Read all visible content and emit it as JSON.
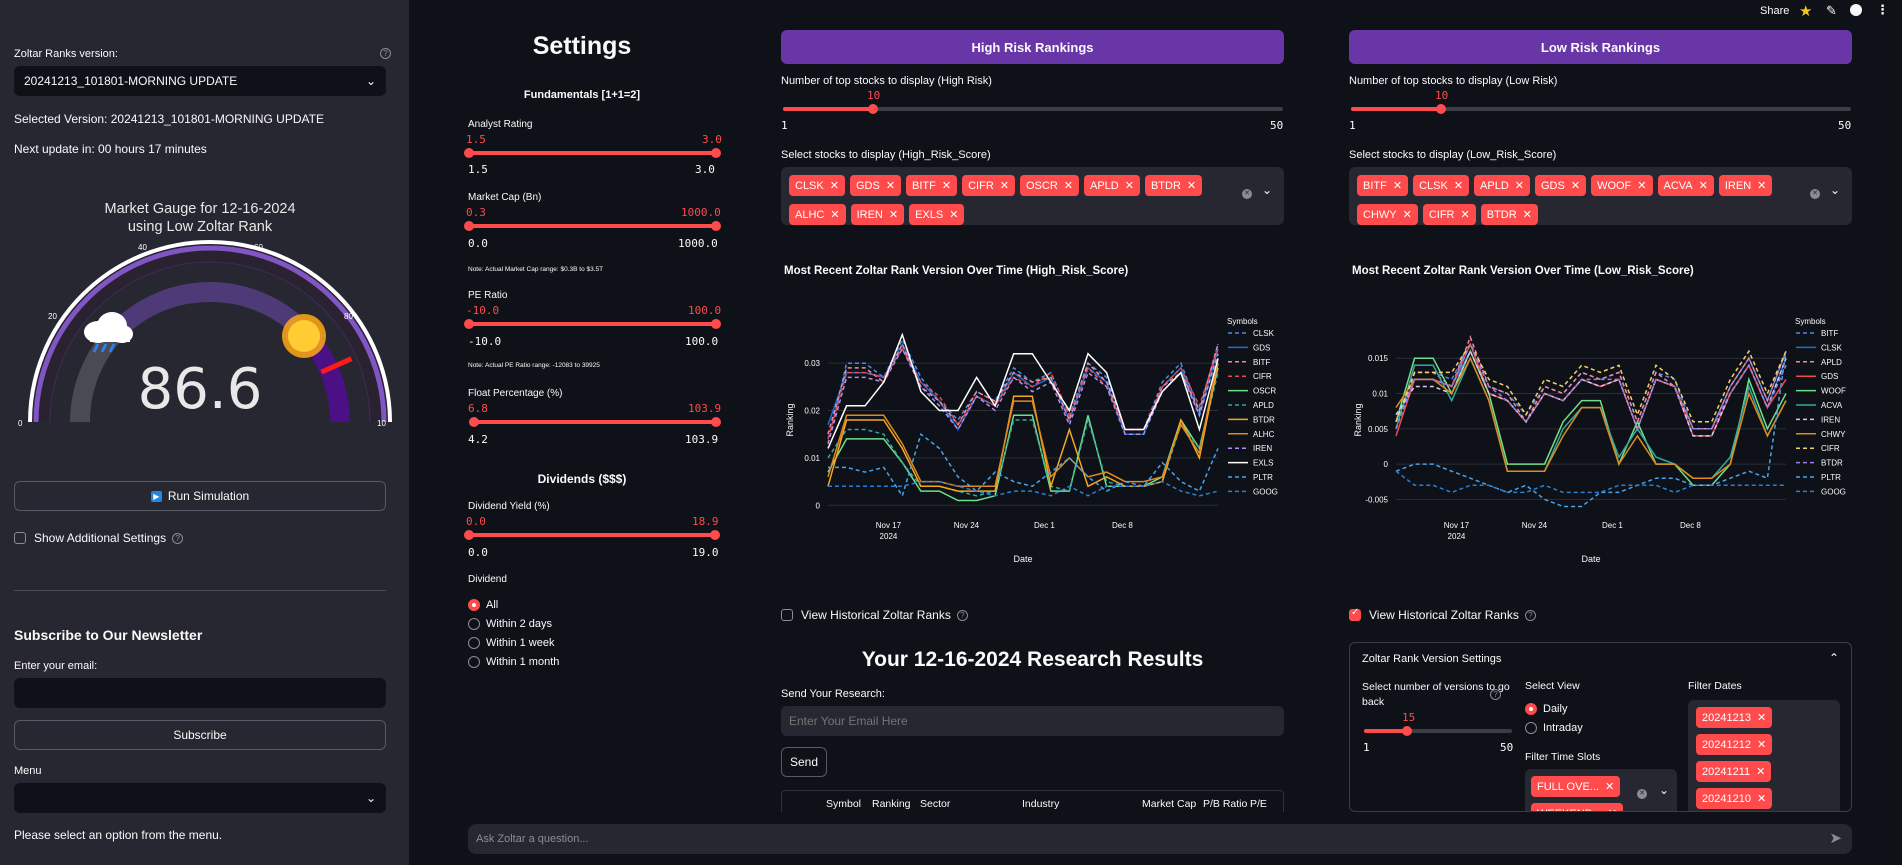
{
  "toolbar": {
    "share": "Share"
  },
  "sidebar": {
    "version_label": "Zoltar Ranks version:",
    "version_value": "20241213_101801-MORNING UPDATE",
    "selected_version": "Selected Version: 20241213_101801-MORNING UPDATE",
    "next_update": "Next update in: 00 hours 17 minutes",
    "gauge": {
      "title_line1": "Market Gauge for 12-16-2024",
      "title_line2": "using Low Zoltar Rank",
      "value": "86.6",
      "reading": 86.6,
      "ticks": [
        "0",
        "20",
        "40",
        "60",
        "80",
        "10"
      ]
    },
    "run_simulation": "Run Simulation",
    "show_additional": "Show Additional Settings",
    "newsletter_title": "Subscribe to Our Newsletter",
    "email_label": "Enter your email:",
    "subscribe": "Subscribe",
    "menu_label": "Menu",
    "menu_hint": "Please select an option from the menu."
  },
  "settings": {
    "title": "Settings",
    "fundamentals": "Fundamentals [1+1=2]",
    "analyst": {
      "label": "Analyst Rating",
      "lo": "1.5",
      "hi": "3.0",
      "min": "1.5",
      "max": "3.0"
    },
    "marketcap": {
      "label": "Market Cap (Bn)",
      "lo": "0.3",
      "hi": "1000.0",
      "min": "0.0",
      "max": "1000.0",
      "note": "Note: Actual Market Cap range: $0.3B to $3.5T"
    },
    "pe": {
      "label": "PE Ratio",
      "lo": "-10.0",
      "hi": "100.0",
      "min": "-10.0",
      "max": "100.0",
      "note": "Note: Actual PE Ratio range: -12083 to 39925"
    },
    "float": {
      "label": "Float Percentage (%)",
      "lo": "6.8",
      "hi": "103.9",
      "min": "4.2",
      "max": "103.9"
    },
    "dividends": "Dividends ($$$)",
    "divyield": {
      "label": "Dividend Yield (%)",
      "lo": "0.0",
      "hi": "18.9",
      "min": "0.0",
      "max": "19.0"
    },
    "dividend_label": "Dividend",
    "dividend_options": [
      "All",
      "Within 2 days",
      "Within 1 week",
      "Within 1 month"
    ]
  },
  "high": {
    "title": "High Risk Rankings",
    "num_label": "Number of top stocks to display (High Risk)",
    "num_value": "10",
    "num_min": "1",
    "num_max": "50",
    "select_label": "Select stocks to display (High_Risk_Score)",
    "tags": [
      "CLSK",
      "GDS",
      "BITF",
      "CIFR",
      "OSCR",
      "APLD",
      "BTDR",
      "ALHC",
      "IREN",
      "EXLS"
    ],
    "chart_title": "Most Recent Zoltar Rank Version Over Time (High_Risk_Score)",
    "view_hist": "View Historical Zoltar Ranks"
  },
  "low": {
    "title": "Low Risk Rankings",
    "num_label": "Number of top stocks to display (Low Risk)",
    "num_value": "10",
    "num_min": "1",
    "num_max": "50",
    "select_label": "Select stocks to display (Low_Risk_Score)",
    "tags": [
      "BITF",
      "CLSK",
      "APLD",
      "GDS",
      "WOOF",
      "ACVA",
      "IREN",
      "CHWY",
      "CIFR",
      "BTDR"
    ],
    "chart_title": "Most Recent Zoltar Rank Version Over Time (Low_Risk_Score)",
    "view_hist": "View Historical Zoltar Ranks"
  },
  "research": {
    "title": "Your 12-16-2024 Research Results",
    "send_label": "Send Your Research:",
    "email_placeholder": "Enter Your Email Here",
    "send": "Send",
    "columns": [
      "Symbol",
      "Ranking",
      "Sector",
      "Industry",
      "Market Cap",
      "P/B Ratio",
      "P/E Ra"
    ]
  },
  "version_settings": {
    "title": "Zoltar Rank Version Settings",
    "num_label_1": "Select number of versions to go",
    "num_label_2": "back",
    "num_value": "15",
    "num_min": "1",
    "num_max": "50",
    "view_label": "Select View",
    "view_options": [
      "Daily",
      "Intraday"
    ],
    "slots_label": "Filter Time Slots",
    "slots": [
      "FULL OVE...",
      "WEEKEND..."
    ],
    "dates_label": "Filter Dates",
    "dates": [
      "20241213",
      "20241212",
      "20241211",
      "20241210"
    ]
  },
  "chat": {
    "placeholder": "Ask Zoltar a question..."
  },
  "chart_data": [
    {
      "type": "line",
      "title": "Most Recent Zoltar Rank Version Over Time (High_Risk_Score)",
      "xlabel": "Date",
      "ylabel": "Ranking",
      "legend_title": "Symbols",
      "legend_position": "right",
      "x_ticks": [
        "Nov 17\n2024",
        "Nov 24",
        "Dec 1",
        "Dec 8"
      ],
      "y_ticks": [
        "0",
        "0.01",
        "0.02",
        "0.03"
      ],
      "ylim": [
        -0.001,
        0.037
      ],
      "series": [
        {
          "name": "CLSK",
          "color": "#4c8ce8",
          "dash": true,
          "values": [
            0.013,
            0.03,
            0.03,
            0.027,
            0.035,
            0.027,
            0.022,
            0.018,
            0.024,
            0.022,
            0.029,
            0.026,
            0.028,
            0.019,
            0.03,
            0.027,
            0.016,
            0.016,
            0.026,
            0.03,
            0.02,
            0.034
          ]
        },
        {
          "name": "GDS",
          "color": "#1f6fd0",
          "dash": false,
          "values": [
            0.017,
            0.028,
            0.028,
            0.027,
            0.034,
            0.026,
            0.022,
            0.016,
            0.023,
            0.021,
            0.028,
            0.025,
            0.027,
            0.018,
            0.029,
            0.026,
            0.015,
            0.015,
            0.025,
            0.029,
            0.019,
            0.033
          ]
        },
        {
          "name": "BITF",
          "color": "#f08aa0",
          "dash": true,
          "values": [
            0.015,
            0.029,
            0.029,
            0.026,
            0.034,
            0.025,
            0.022,
            0.017,
            0.024,
            0.022,
            0.028,
            0.026,
            0.027,
            0.018,
            0.03,
            0.026,
            0.016,
            0.016,
            0.025,
            0.028,
            0.02,
            0.034
          ]
        },
        {
          "name": "CIFR",
          "color": "#ef4b4b",
          "dash": true,
          "values": [
            0.014,
            0.028,
            0.028,
            0.027,
            0.033,
            0.026,
            0.023,
            0.017,
            0.023,
            0.021,
            0.027,
            0.025,
            0.028,
            0.019,
            0.029,
            0.025,
            0.016,
            0.016,
            0.025,
            0.029,
            0.021,
            0.033
          ]
        },
        {
          "name": "OSCR",
          "color": "#6fe08a",
          "dash": false,
          "values": [
            0.007,
            0.014,
            0.014,
            0.014,
            0.009,
            0.003,
            0.003,
            0.001,
            0.001,
            0.002,
            0.019,
            0.019,
            0.003,
            0.003,
            0.019,
            0.004,
            0.004,
            0.004,
            0.006,
            0.018,
            0.012,
            0.029
          ]
        },
        {
          "name": "APLD",
          "color": "#35a7a0",
          "dash": true,
          "values": [
            0.01,
            0.016,
            0.016,
            0.015,
            0.009,
            0.004,
            0.004,
            0.003,
            0.002,
            0.003,
            0.018,
            0.018,
            0.004,
            0.003,
            0.018,
            0.005,
            0.004,
            0.004,
            0.005,
            0.017,
            0.012,
            0.028
          ]
        },
        {
          "name": "BTDR",
          "color": "#f5a623",
          "dash": false,
          "values": [
            0.004,
            0.018,
            0.018,
            0.018,
            0.012,
            0.004,
            0.004,
            0.003,
            0.003,
            0.003,
            0.023,
            0.023,
            0.004,
            0.016,
            0.004,
            0.006,
            0.004,
            0.004,
            0.005,
            0.018,
            0.01,
            0.03
          ]
        },
        {
          "name": "ALHC",
          "color": "#e08a1e",
          "dash": false,
          "values": [
            0.006,
            0.019,
            0.019,
            0.019,
            0.013,
            0.005,
            0.005,
            0.004,
            0.004,
            0.004,
            0.022,
            0.022,
            0.006,
            0.01,
            0.006,
            0.007,
            0.005,
            0.005,
            0.006,
            0.017,
            0.011,
            0.031
          ]
        },
        {
          "name": "IREN",
          "color": "#b18cf2",
          "dash": true,
          "values": [
            0.013,
            0.027,
            0.027,
            0.026,
            0.033,
            0.025,
            0.021,
            0.016,
            0.023,
            0.02,
            0.027,
            0.024,
            0.026,
            0.017,
            0.028,
            0.025,
            0.015,
            0.015,
            0.024,
            0.028,
            0.019,
            0.032
          ]
        },
        {
          "name": "EXLS",
          "color": "#ffffff",
          "dash": false,
          "values": [
            0.012,
            0.021,
            0.021,
            0.026,
            0.036,
            0.024,
            0.02,
            0.02,
            0.027,
            0.021,
            0.032,
            0.032,
            0.026,
            0.02,
            0.032,
            0.028,
            0.016,
            0.016,
            0.024,
            0.028,
            0.016,
            0.031
          ]
        },
        {
          "name": "PLTR",
          "color": "#4aa3e8",
          "dash": true,
          "values": [
            0.008,
            0.008,
            0.007,
            0.008,
            0.002,
            0.015,
            0.012,
            0.006,
            0.003,
            0.007,
            0.005,
            0.004,
            0.007,
            0.01,
            0.006,
            0.003,
            0.005,
            0.004,
            0.009,
            0.005,
            0.003,
            0.012
          ]
        },
        {
          "name": "GOOG",
          "color": "#2a7fd4",
          "dash": true,
          "values": [
            0.004,
            0.004,
            0.004,
            0.004,
            0.004,
            0.005,
            0.005,
            0.004,
            0.003,
            0.002,
            0.003,
            0.003,
            0.002,
            0.004,
            0.002,
            0.004,
            0.004,
            0.004,
            0.005,
            0.003,
            0.002,
            0.003
          ]
        }
      ]
    },
    {
      "type": "line",
      "title": "Most Recent Zoltar Rank Version Over Time (Low_Risk_Score)",
      "xlabel": "Date",
      "ylabel": "Ranking",
      "legend_title": "Symbols",
      "legend_position": "right",
      "x_ticks": [
        "Nov 17\n2024",
        "Nov 24",
        "Dec 1",
        "Dec 8"
      ],
      "y_ticks": [
        "-0.005",
        "0",
        "0.005",
        "0.01",
        "0.015"
      ],
      "ylim": [
        -0.0065,
        0.019
      ],
      "series": [
        {
          "name": "BITF",
          "color": "#4c8ce8",
          "dash": true,
          "values": [
            0.005,
            0.013,
            0.013,
            0.012,
            0.017,
            0.011,
            0.01,
            0.007,
            0.011,
            0.01,
            0.013,
            0.012,
            0.013,
            0.006,
            0.013,
            0.012,
            0.005,
            0.005,
            0.011,
            0.015,
            0.009,
            0.016
          ]
        },
        {
          "name": "CLSK",
          "color": "#1f6fd0",
          "dash": false,
          "values": [
            0.006,
            0.012,
            0.012,
            0.011,
            0.016,
            0.01,
            0.009,
            0.006,
            0.01,
            0.009,
            0.012,
            0.011,
            0.012,
            0.005,
            0.012,
            0.011,
            0.004,
            0.004,
            0.01,
            0.014,
            0.008,
            0.015
          ]
        },
        {
          "name": "APLD",
          "color": "#f08aa0",
          "dash": true,
          "values": [
            0.005,
            0.013,
            0.013,
            0.011,
            0.018,
            0.011,
            0.01,
            0.006,
            0.011,
            0.01,
            0.013,
            0.012,
            0.013,
            0.006,
            0.013,
            0.011,
            0.005,
            0.005,
            0.011,
            0.015,
            0.009,
            0.016
          ]
        },
        {
          "name": "GDS",
          "color": "#ef4b4b",
          "dash": false,
          "values": [
            0.004,
            0.012,
            0.012,
            0.011,
            0.017,
            0.01,
            0.009,
            0.006,
            0.01,
            0.009,
            0.012,
            0.011,
            0.012,
            0.005,
            0.012,
            0.011,
            0.004,
            0.004,
            0.01,
            0.014,
            0.008,
            0.012
          ]
        },
        {
          "name": "WOOF",
          "color": "#6fe08a",
          "dash": false,
          "values": [
            0.006,
            0.015,
            0.015,
            0.01,
            0.016,
            0.01,
            0.0,
            0.0,
            0.0,
            0.006,
            0.009,
            0.009,
            0.0,
            0.006,
            0.0,
            0.0,
            -0.003,
            -0.003,
            0.0,
            0.012,
            0.005,
            0.01
          ]
        },
        {
          "name": "ACVA",
          "color": "#35a7a0",
          "dash": false,
          "values": [
            0.005,
            0.014,
            0.014,
            0.009,
            0.015,
            0.009,
            -0.001,
            -0.001,
            -0.001,
            0.005,
            0.008,
            0.008,
            0.001,
            0.005,
            0.001,
            0.0,
            -0.002,
            -0.002,
            0.001,
            0.011,
            0.004,
            0.009
          ]
        },
        {
          "name": "IREN",
          "color": "#d9c9f0",
          "dash": true,
          "values": [
            0.007,
            0.011,
            0.011,
            0.01,
            0.016,
            0.01,
            0.009,
            0.006,
            0.01,
            0.009,
            0.012,
            0.011,
            0.012,
            0.005,
            0.012,
            0.011,
            0.004,
            0.004,
            0.01,
            0.014,
            0.008,
            0.015
          ]
        },
        {
          "name": "CHWY",
          "color": "#e08a1e",
          "dash": false,
          "values": [
            0.008,
            0.012,
            0.012,
            0.01,
            0.015,
            0.009,
            -0.001,
            -0.001,
            -0.001,
            0.004,
            0.008,
            0.008,
            0.0,
            0.004,
            0.0,
            0.0,
            -0.002,
            -0.002,
            0.0,
            0.01,
            0.004,
            0.009
          ]
        },
        {
          "name": "CIFR",
          "color": "#f5d06b",
          "dash": true,
          "values": [
            0.006,
            0.013,
            0.013,
            0.013,
            0.017,
            0.012,
            0.011,
            0.007,
            0.012,
            0.011,
            0.014,
            0.013,
            0.014,
            0.007,
            0.014,
            0.012,
            0.006,
            0.006,
            0.012,
            0.016,
            0.01,
            0.016
          ]
        },
        {
          "name": "BTDR",
          "color": "#9b7fe0",
          "dash": true,
          "values": [
            0.005,
            0.012,
            0.012,
            0.011,
            0.017,
            0.011,
            0.009,
            0.006,
            0.01,
            0.009,
            0.012,
            0.012,
            0.012,
            0.005,
            0.012,
            0.011,
            0.005,
            0.005,
            0.01,
            0.014,
            0.008,
            0.014
          ]
        },
        {
          "name": "PLTR",
          "color": "#4aa3e8",
          "dash": true,
          "values": [
            -0.001,
            0.0,
            0.0,
            -0.001,
            -0.002,
            -0.003,
            -0.004,
            -0.003,
            -0.005,
            -0.006,
            -0.006,
            -0.004,
            -0.004,
            -0.003,
            -0.002,
            -0.002,
            -0.003,
            -0.003,
            -0.002,
            -0.001,
            -0.002,
            0.016
          ]
        },
        {
          "name": "GOOG",
          "color": "#2a7fd4",
          "dash": true,
          "values": [
            -0.001,
            -0.003,
            -0.003,
            -0.004,
            -0.003,
            -0.003,
            -0.004,
            -0.004,
            -0.003,
            -0.004,
            -0.004,
            -0.004,
            -0.003,
            -0.003,
            -0.003,
            -0.004,
            -0.003,
            -0.003,
            -0.003,
            -0.003,
            -0.003,
            -0.003
          ]
        }
      ]
    }
  ]
}
